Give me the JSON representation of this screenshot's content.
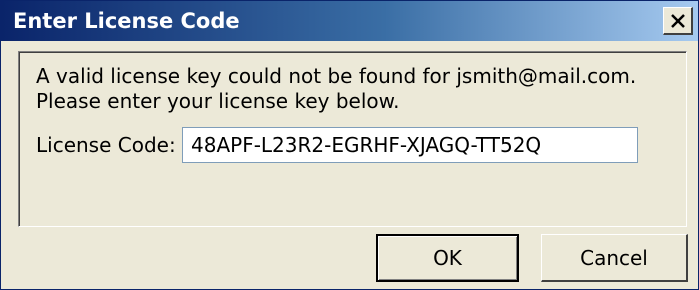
{
  "window": {
    "title": "Enter License Code",
    "close_icon": "close-icon"
  },
  "message": {
    "line1": "A valid license key could not be found for jsmith@mail.com.",
    "line2": "Please enter your license key below."
  },
  "license_field": {
    "label": "License Code:",
    "value": "48APF-L23R2-EGRHF-XJAGQ-TT52Q"
  },
  "buttons": {
    "ok_label": "OK",
    "cancel_label": "Cancel"
  },
  "colors": {
    "title_bar_start": "#0a246a",
    "title_bar_end": "#a6caf0",
    "dialog_background": "#ece9d8"
  }
}
